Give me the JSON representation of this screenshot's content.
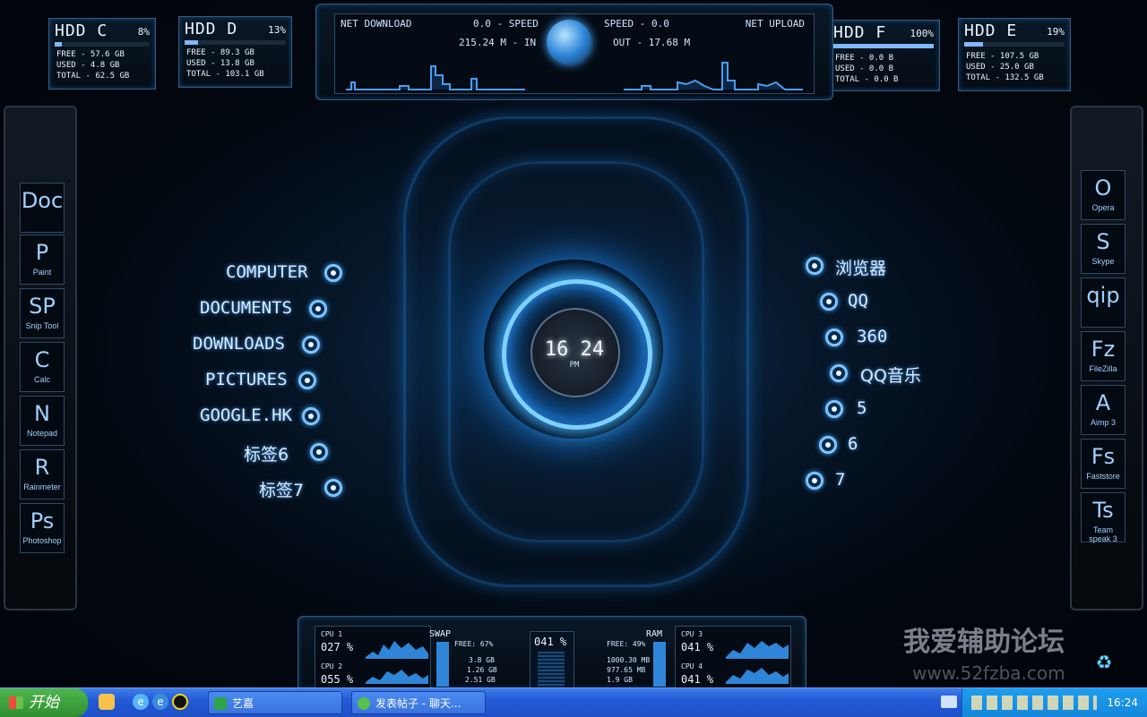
{
  "drives": [
    {
      "name": "HDD C",
      "percent": "8%",
      "fill": 0.08,
      "free": "FREE - 57.6 GB",
      "used": "USED - 4.8 GB",
      "total": "TOTAL - 62.5 GB"
    },
    {
      "name": "HDD D",
      "percent": "13%",
      "fill": 0.13,
      "free": "FREE - 89.3 GB",
      "used": "USED - 13.8 GB",
      "total": "TOTAL - 103.1 GB"
    },
    {
      "name": "HDD F",
      "percent": "100%",
      "fill": 1.0,
      "free": "FREE - 0.0 B",
      "used": "USED - 0.0 B",
      "total": "TOTAL - 0.0 B"
    },
    {
      "name": "HDD E",
      "percent": "19%",
      "fill": 0.19,
      "free": "FREE - 107.5 GB",
      "used": "USED - 25.0 GB",
      "total": "TOTAL - 132.5 GB"
    }
  ],
  "network": {
    "download_label": "NET DOWNLOAD",
    "upload_label": "NET UPLOAD",
    "down_speed": "0.0  - SPEED",
    "up_speed": "SPEED - 0.0",
    "total_in": "215.24 M - IN",
    "total_out": "OUT - 17.68 M"
  },
  "clock": {
    "time": "16 24",
    "ampm": "PM"
  },
  "left_links": [
    "COMPUTER",
    "DOCUMENTS",
    "DOWNLOADS",
    "PICTURES",
    "GOOGLE.HK",
    "标签6",
    "标签7"
  ],
  "right_links": [
    "浏览器",
    "QQ",
    "360",
    "QQ音乐",
    "5",
    "6",
    "7"
  ],
  "left_dock": [
    {
      "big": "Doc",
      "small": ""
    },
    {
      "big": "P",
      "small": "Paint"
    },
    {
      "big": "SP",
      "small": "Snip Tool"
    },
    {
      "big": "C",
      "small": "Calc"
    },
    {
      "big": "N",
      "small": "Notepad"
    },
    {
      "big": "R",
      "small": "Rainmeter"
    },
    {
      "big": "Ps",
      "small": "Photoshop"
    }
  ],
  "right_dock": [
    {
      "big": "O",
      "small": "Opera"
    },
    {
      "big": "S",
      "small": "Skype"
    },
    {
      "big": "qip",
      "small": ""
    },
    {
      "big": "Fz",
      "small": "FileZilla"
    },
    {
      "big": "A",
      "small": "Aimp 3"
    },
    {
      "big": "Fs",
      "small": "Faststore"
    },
    {
      "big": "Ts",
      "small": "Team speak 3"
    }
  ],
  "system": {
    "cpu1_label": "CPU 1",
    "cpu1_value": "027 %",
    "cpu2_label": "CPU 2",
    "cpu2_value": "055 %",
    "cpu3_label": "CPU 3",
    "cpu3_value": "041 %",
    "cpu4_label": "CPU 4",
    "cpu4_value": "041 %",
    "swap_label": "SWAP",
    "swap_free": "FREE: 67%",
    "swap_values": [
      "3.8 GB",
      "1.26 GB",
      "2.51 GB"
    ],
    "center_value": "041 %",
    "ram_label": "RAM",
    "ram_free": "FREE: 49%",
    "ram_values": [
      "1000.30 MB",
      "977.65 MB",
      "1.9 GB"
    ]
  },
  "watermark": {
    "text": "我爱辅助论坛",
    "url": "www.52fzba.com"
  },
  "taskbar": {
    "start_label": "开始",
    "windows": [
      "艺嘉",
      "发表帖子 - 聊天..."
    ],
    "clock": "16:24"
  },
  "colors": {
    "accent": "#49a8ff",
    "taskbar": "#245ad6",
    "start": "#3fa63f"
  }
}
